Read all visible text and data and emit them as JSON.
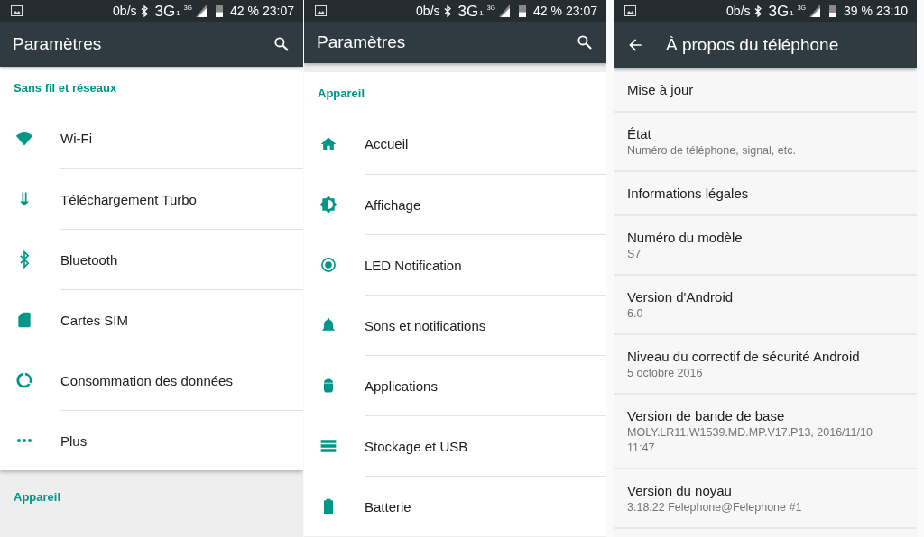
{
  "screens": [
    {
      "status_bar": {
        "speed": "0b/s",
        "network": "3G",
        "network_index": "1",
        "network_small": "3G",
        "battery": "42 %",
        "time": "23:07"
      },
      "toolbar": {
        "title": "Paramètres",
        "kind": "search"
      },
      "sections": [
        {
          "header": "Sans fil et réseaux",
          "items": [
            {
              "label": "Wi-Fi"
            },
            {
              "label": "Téléchargement Turbo"
            },
            {
              "label": "Bluetooth"
            },
            {
              "label": "Cartes SIM"
            },
            {
              "label": "Consommation des données"
            },
            {
              "label": "Plus"
            }
          ]
        },
        {
          "header": "Appareil"
        }
      ]
    },
    {
      "status_bar": {
        "speed": "0b/s",
        "network": "3G",
        "network_index": "1",
        "network_small": "3G",
        "battery": "42 %",
        "time": "23:07"
      },
      "toolbar": {
        "title": "Paramètres",
        "kind": "search"
      },
      "sections": [
        {
          "header": "Appareil",
          "items": [
            {
              "label": "Accueil"
            },
            {
              "label": "Affichage"
            },
            {
              "label": "LED Notification"
            },
            {
              "label": "Sons et notifications"
            },
            {
              "label": "Applications"
            },
            {
              "label": "Stockage et USB"
            },
            {
              "label": "Batterie"
            }
          ]
        }
      ]
    },
    {
      "status_bar": {
        "speed": "0b/s",
        "network": "3G",
        "network_index": "1",
        "network_small": "3G",
        "battery": "39 %",
        "time": "23:10"
      },
      "toolbar": {
        "title": "À propos du téléphone",
        "kind": "back"
      },
      "details": [
        {
          "title": "Mise à jour"
        },
        {
          "title": "État",
          "summary": "Numéro de téléphone, signal, etc."
        },
        {
          "title": "Informations légales"
        },
        {
          "title": "Numéro du modèle",
          "summary": "S7"
        },
        {
          "title": "Version d'Android",
          "summary": "6.0"
        },
        {
          "title": "Niveau du correctif de sécurité Android",
          "summary": "5 octobre 2016"
        },
        {
          "title": "Version de bande de base",
          "summary": "MOLY.LR11.W1539.MD.MP.V17.P13, 2016/11/10 11:47"
        },
        {
          "title": "Version du noyau",
          "summary": "3.18.22 Felephone@Felephone #1"
        }
      ]
    }
  ]
}
